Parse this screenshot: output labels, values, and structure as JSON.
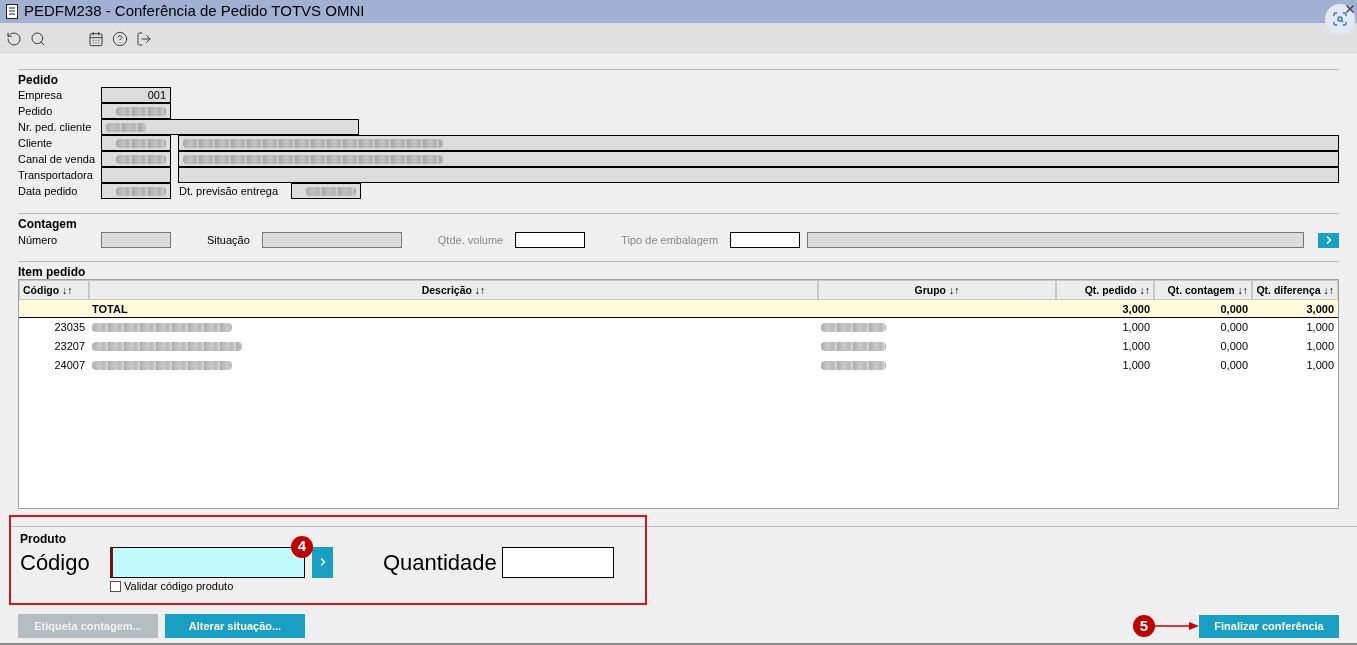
{
  "window": {
    "title": "PEDFM238 - Conferência de Pedido TOTVS OMNI"
  },
  "toolbar": [
    {
      "kind": "undo"
    },
    {
      "kind": "search"
    },
    {
      "kind": "gap"
    },
    {
      "kind": "calendar"
    },
    {
      "kind": "help"
    },
    {
      "kind": "exit"
    }
  ],
  "pedido": {
    "title": "Pedido",
    "rows": [
      {
        "label": "Empresa",
        "fields": [
          {
            "kind": "short",
            "value": "001",
            "redacted": false
          }
        ]
      },
      {
        "label": "Pedido",
        "fields": [
          {
            "kind": "short",
            "redacted": true
          }
        ]
      },
      {
        "label": "Nr. ped. cliente",
        "fields": [
          {
            "kind": "medium",
            "redacted": true
          }
        ]
      },
      {
        "label": "Cliente",
        "fields": [
          {
            "kind": "short",
            "redacted": true
          },
          {
            "kind": "full",
            "redacted": true
          }
        ]
      },
      {
        "label": "Canal de venda",
        "fields": [
          {
            "kind": "short",
            "redacted": true
          },
          {
            "kind": "full",
            "redacted": true
          }
        ]
      },
      {
        "label": "Transportadora",
        "fields": [
          {
            "kind": "short",
            "redacted": false
          },
          {
            "kind": "full",
            "redacted": false
          }
        ]
      },
      {
        "label": "Data pedido",
        "fields": [
          {
            "kind": "short",
            "redacted": true
          },
          {
            "kind": "label",
            "text": "Dt. previsão entrega"
          },
          {
            "kind": "short",
            "redacted": true
          }
        ]
      }
    ]
  },
  "contagem": {
    "title": "Contagem",
    "items": [
      {
        "label": "Número",
        "disabled": false,
        "fields": [
          {
            "kind": "short",
            "editable": false
          }
        ]
      },
      {
        "label": "Situação",
        "disabled": false,
        "fields": [
          {
            "kind": "medium",
            "editable": false
          }
        ]
      },
      {
        "label": "Qtde. volume",
        "disabled": true,
        "fields": [
          {
            "kind": "short",
            "editable": true
          }
        ]
      },
      {
        "label": "Tipo de embalagem",
        "disabled": true,
        "fields": [
          {
            "kind": "short",
            "editable": true
          },
          {
            "kind": "fill",
            "editable": false
          }
        ]
      }
    ]
  },
  "item_pedido": {
    "title": "Item pedido",
    "columns": [
      {
        "label": "Código ↓↑"
      },
      {
        "label": "Descrição ↓↑"
      },
      {
        "label": "Grupo ↓↑"
      },
      {
        "label": "Qt. pedido ↓↑"
      },
      {
        "label": "Qt. contagem ↓↑"
      },
      {
        "label": "Qt. diferença ↓↑"
      }
    ],
    "total": {
      "label": "TOTAL",
      "qt_pedido": "3,000",
      "qt_contagem": "0,000",
      "qt_diferenca": "3,000"
    },
    "rows": [
      {
        "codigo": "23035",
        "qt_pedido": "1,000",
        "qt_contagem": "0,000",
        "qt_diferenca": "1,000"
      },
      {
        "codigo": "23207",
        "qt_pedido": "1,000",
        "qt_contagem": "0,000",
        "qt_diferenca": "1,000"
      },
      {
        "codigo": "24007",
        "qt_pedido": "1,000",
        "qt_contagem": "0,000",
        "qt_diferenca": "1,000"
      }
    ]
  },
  "produto": {
    "title": "Produto",
    "codigo_label": "Código",
    "codigo_focused": true,
    "quantidade_label": "Quantidade",
    "checkbox": {
      "label": "Validar código produto",
      "checked": false
    },
    "callout": "4"
  },
  "buttons": [
    {
      "label": "Etiqueta contagem...",
      "disabled": true
    },
    {
      "label": "Alterar situação...",
      "disabled": false
    }
  ],
  "finalizar": {
    "label": "Finalizar conferência",
    "disabled": false,
    "callout": "5"
  }
}
